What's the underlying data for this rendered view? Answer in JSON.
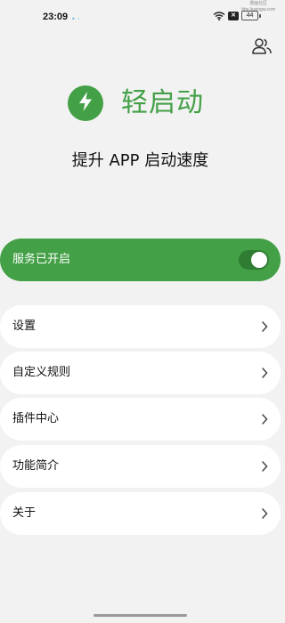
{
  "status_bar": {
    "time": "23:09",
    "dots": "• ˒",
    "x_badge": "✕",
    "battery": "44",
    "watermark_line1": "漫画社区",
    "watermark_line2": "bbs.liuxingw.com"
  },
  "header": {
    "app_name": "轻启动",
    "tagline": "提升 APP 启动速度"
  },
  "service": {
    "label": "服务已开启",
    "enabled": true
  },
  "menu": {
    "items": [
      {
        "label": "设置"
      },
      {
        "label": "自定义规则"
      },
      {
        "label": "插件中心"
      },
      {
        "label": "功能简介"
      },
      {
        "label": "关于"
      }
    ]
  },
  "icons": {
    "logo": "lightning-bolt-icon",
    "account": "users-icon",
    "chevron": "chevron-right-icon"
  },
  "colors": {
    "accent": "#43a047",
    "background": "#f2f2f2",
    "card": "#ffffff"
  }
}
